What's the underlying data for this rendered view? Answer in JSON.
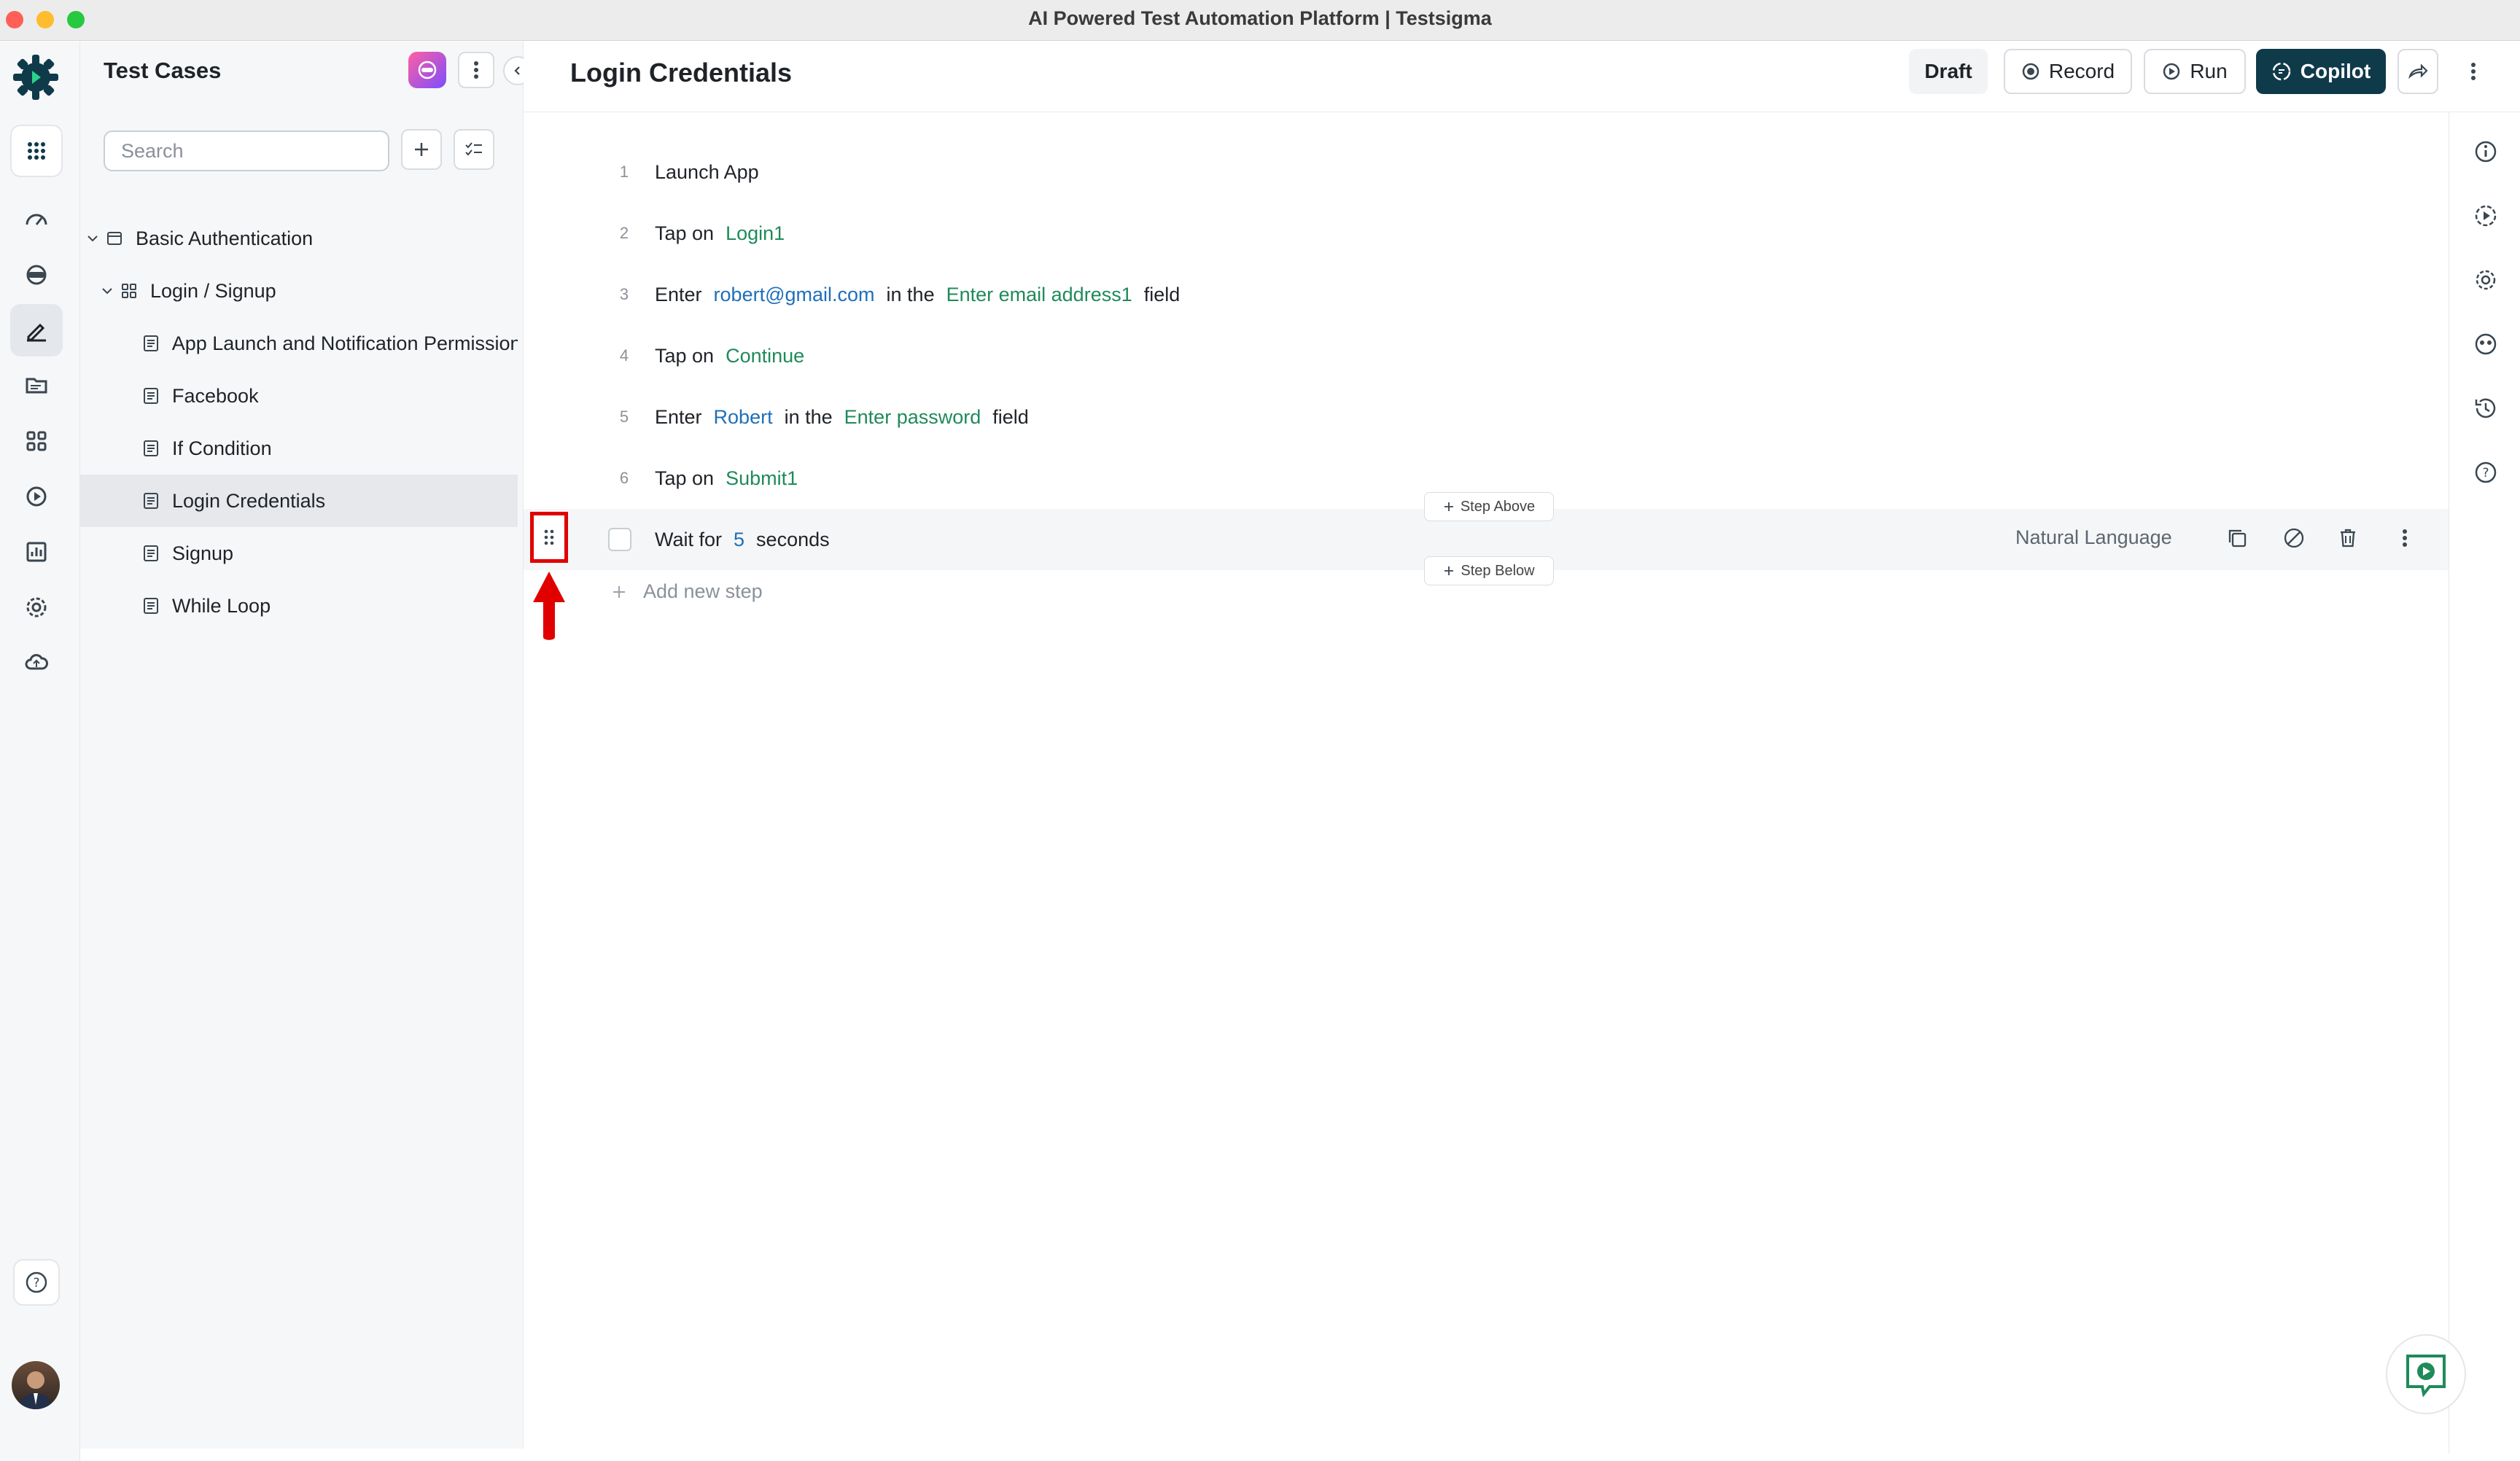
{
  "window": {
    "title": "AI Powered Test Automation Platform | Testsigma"
  },
  "sidebar": {
    "title": "Test Cases",
    "search_placeholder": "Search",
    "tree": [
      {
        "label": "Basic Authentication",
        "level": 0,
        "type": "suite",
        "expanded": true
      },
      {
        "label": "Login / Signup",
        "level": 1,
        "type": "group",
        "expanded": true
      },
      {
        "label": "App Launch and Notification Permission",
        "level": 2,
        "type": "case"
      },
      {
        "label": "Facebook",
        "level": 2,
        "type": "case"
      },
      {
        "label": "If Condition",
        "level": 2,
        "type": "case"
      },
      {
        "label": "Login Credentials",
        "level": 2,
        "type": "case",
        "selected": true
      },
      {
        "label": "Signup",
        "level": 2,
        "type": "case"
      },
      {
        "label": "While Loop",
        "level": 2,
        "type": "case"
      }
    ]
  },
  "header": {
    "title": "Login Credentials",
    "status": "Draft",
    "record_label": "Record",
    "run_label": "Run",
    "copilot_label": "Copilot"
  },
  "steps": [
    {
      "num": "1",
      "parts": [
        {
          "t": "Launch App"
        }
      ]
    },
    {
      "num": "2",
      "parts": [
        {
          "t": "Tap on"
        },
        {
          "t": "Login1",
          "k": "elem"
        }
      ]
    },
    {
      "num": "3",
      "parts": [
        {
          "t": "Enter"
        },
        {
          "t": "robert@gmail.com",
          "k": "data"
        },
        {
          "t": "in the"
        },
        {
          "t": "Enter email address1",
          "k": "elem"
        },
        {
          "t": "field"
        }
      ]
    },
    {
      "num": "4",
      "parts": [
        {
          "t": "Tap on"
        },
        {
          "t": "Continue",
          "k": "elem"
        }
      ]
    },
    {
      "num": "5",
      "parts": [
        {
          "t": "Enter"
        },
        {
          "t": "Robert",
          "k": "data"
        },
        {
          "t": "in the"
        },
        {
          "t": "Enter password",
          "k": "elem"
        },
        {
          "t": "field"
        }
      ]
    },
    {
      "num": "6",
      "parts": [
        {
          "t": "Tap on"
        },
        {
          "t": "Submit1",
          "k": "elem"
        }
      ]
    }
  ],
  "active_step": {
    "parts": [
      {
        "t": "Wait for"
      },
      {
        "t": "5",
        "k": "data"
      },
      {
        "t": "seconds"
      }
    ],
    "mode_label": "Natural Language",
    "step_above_label": "Step Above",
    "step_below_label": "Step Below"
  },
  "add_step_label": "Add new step",
  "colors": {
    "accent": "#0f3a4a",
    "element": "#1f8a5a",
    "test_data": "#1f6fb8",
    "highlight": "#e00000"
  },
  "icons": {
    "left_rail": [
      "testsigma-logo",
      "apps-grid-icon",
      "dashboard-icon",
      "device-icon",
      "edit-icon",
      "folder-icon",
      "grid-icon",
      "run-icon",
      "report-icon",
      "settings-icon",
      "cloud-icon",
      "help-icon",
      "avatar"
    ],
    "right_rail": [
      "info-icon",
      "run-history-icon",
      "settings-icon",
      "mask-icon",
      "history-icon",
      "help-icon"
    ]
  }
}
